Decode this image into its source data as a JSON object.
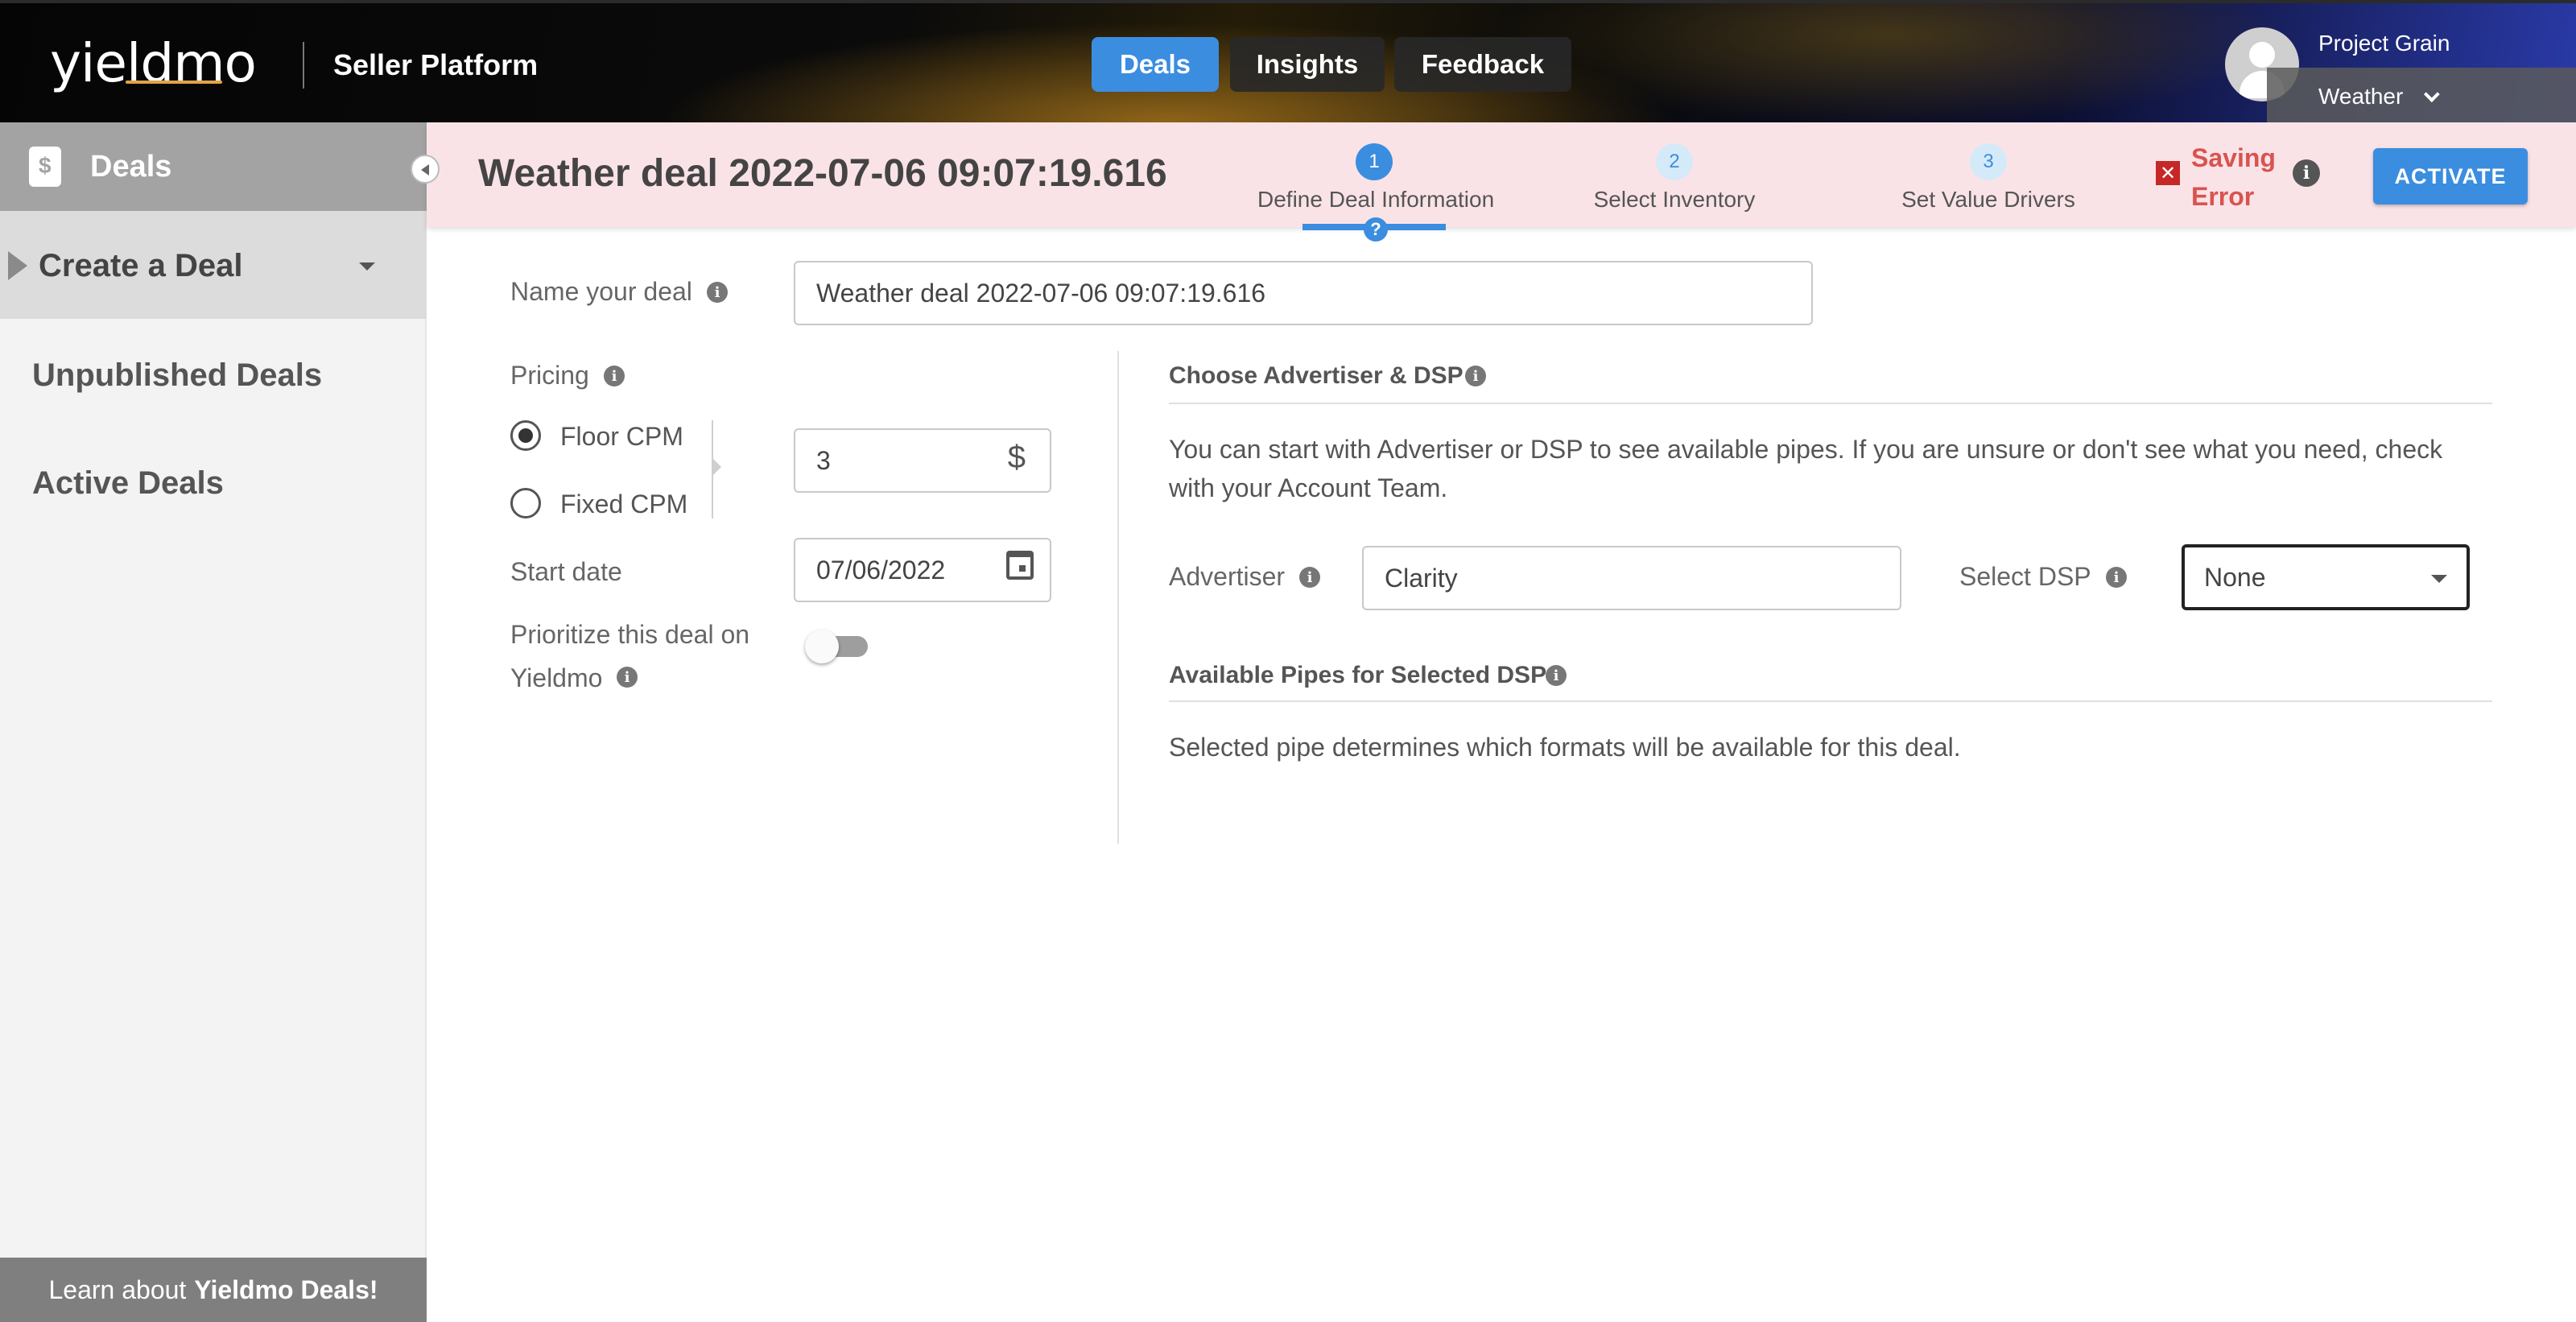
{
  "header": {
    "logo_text": "yieldmo",
    "platform": "Seller Platform",
    "nav": [
      {
        "label": "Deals",
        "active": true
      },
      {
        "label": "Insights",
        "active": false
      },
      {
        "label": "Feedback",
        "active": false
      }
    ],
    "account": {
      "name": "Project Grain",
      "sub": "Weather"
    }
  },
  "sidebar": {
    "section": "Deals",
    "items": [
      {
        "label": "Create a Deal",
        "selected": true
      },
      {
        "label": "Unpublished Deals"
      },
      {
        "label": "Active Deals"
      }
    ],
    "learn_prefix": "Learn about",
    "learn_bold": "Yieldmo Deals!"
  },
  "deal": {
    "title": "Weather deal 2022-07-06 09:07:19.616",
    "steps": [
      {
        "num": "1",
        "label": "Define Deal Information",
        "status": "current"
      },
      {
        "num": "2",
        "label": "Select Inventory",
        "status": "todo"
      },
      {
        "num": "3",
        "label": "Set Value Drivers",
        "status": "todo"
      }
    ],
    "help_glyph": "?",
    "error_glyph": "✕",
    "error_line1": "Saving",
    "error_line2": "Error",
    "activate_label": "ACTIVATE"
  },
  "form": {
    "name_label": "Name your deal",
    "name_value": "Weather deal 2022-07-06 09:07:19.616",
    "pricing_label": "Pricing",
    "pricing_options": [
      {
        "label": "Floor CPM",
        "checked": true
      },
      {
        "label": "Fixed CPM",
        "checked": false
      }
    ],
    "price_value": "3",
    "currency_symbol": "$",
    "start_date_label": "Start date",
    "start_date_value": "07/06/2022",
    "prioritize_line1": "Prioritize this deal on",
    "prioritize_line2": "Yieldmo",
    "prioritize_on": false
  },
  "advertiser_section": {
    "heading": "Choose Advertiser & DSP",
    "description": "You can start with Advertiser or DSP to see available pipes. If you are unsure or don't see what you need, check with your Account Team.",
    "advertiser_label": "Advertiser",
    "advertiser_value": "Clarity",
    "dsp_label": "Select DSP",
    "dsp_value": "None"
  },
  "pipes_section": {
    "heading": "Available Pipes for Selected DSP",
    "description": "Selected pipe determines which formats will be available for this deal."
  },
  "info_glyph": "i",
  "colors": {
    "accent": "#3b8de0",
    "error": "#d9534f",
    "deal_bar_bg": "#fae3e7",
    "sidebar_bg": "#f3f3f3"
  }
}
